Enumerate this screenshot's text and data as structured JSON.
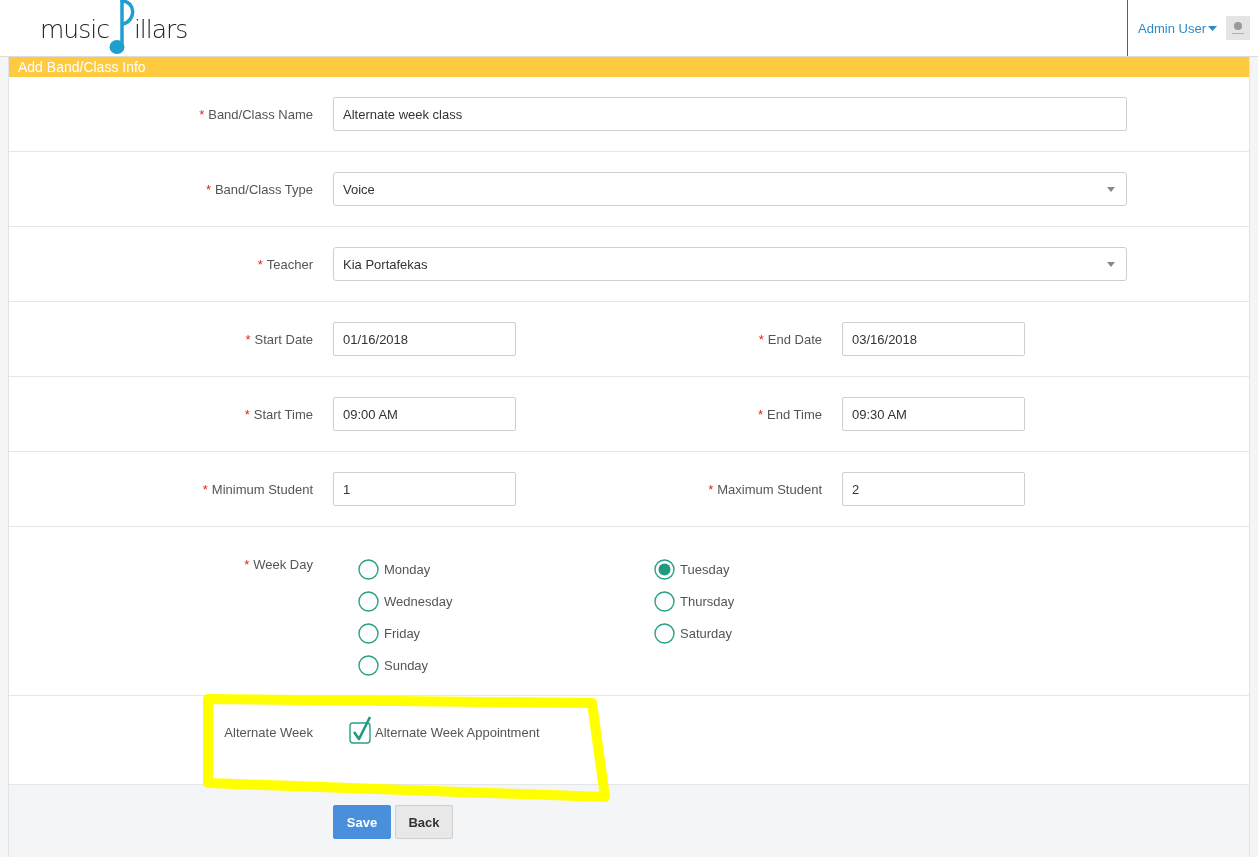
{
  "header": {
    "logo": {
      "text_start": "music",
      "text_end": "illars"
    },
    "user_menu": {
      "label": "Admin User"
    }
  },
  "panel": {
    "title": "Add Band/Class Info"
  },
  "rows": [
    {
      "kind": "fields",
      "fields": [
        {
          "kind": "text",
          "label": "Band/Class Name",
          "required_mark": "*",
          "value": "Alternate week class"
        }
      ]
    },
    {
      "kind": "fields",
      "fields": [
        {
          "kind": "select",
          "label": "Band/Class Type",
          "required_mark": "*",
          "value": "Voice"
        }
      ]
    },
    {
      "kind": "fields",
      "fields": [
        {
          "kind": "select",
          "label": "Teacher",
          "required_mark": "*",
          "value": "Kia Portafekas"
        }
      ]
    },
    {
      "kind": "fields",
      "fields": [
        {
          "kind": "text",
          "label": "Start Date",
          "required_mark": "*",
          "value": "01/16/2018"
        },
        {
          "kind": "text",
          "label": "End Date",
          "required_mark": "*",
          "value": "03/16/2018"
        }
      ]
    },
    {
      "kind": "fields",
      "fields": [
        {
          "kind": "text",
          "label": "Start Time",
          "required_mark": "*",
          "value": "09:00 AM"
        },
        {
          "kind": "text",
          "label": "End Time",
          "required_mark": "*",
          "value": "09:30 AM"
        }
      ]
    },
    {
      "kind": "fields",
      "fields": [
        {
          "kind": "text",
          "label": "Minimum Student",
          "required_mark": "*",
          "value": "1"
        },
        {
          "kind": "text",
          "label": "Maximum Student",
          "required_mark": "*",
          "value": "2"
        }
      ]
    },
    {
      "kind": "radios",
      "label": "Week Day",
      "required_mark": "*",
      "options": [
        {
          "label": "Monday",
          "selected": false
        },
        {
          "label": "Tuesday",
          "selected": true
        },
        {
          "label": "Wednesday",
          "selected": false
        },
        {
          "label": "Thursday",
          "selected": false
        },
        {
          "label": "Friday",
          "selected": false
        },
        {
          "label": "Saturday",
          "selected": false
        },
        {
          "label": "Sunday",
          "selected": false
        }
      ]
    },
    {
      "kind": "checkbox",
      "label": "Alternate Week",
      "option": {
        "label": "Alternate Week Appointment",
        "checked": true
      }
    }
  ],
  "buttons": [
    {
      "label": "Save",
      "kind": "primary"
    },
    {
      "label": "Back",
      "kind": "default"
    }
  ]
}
